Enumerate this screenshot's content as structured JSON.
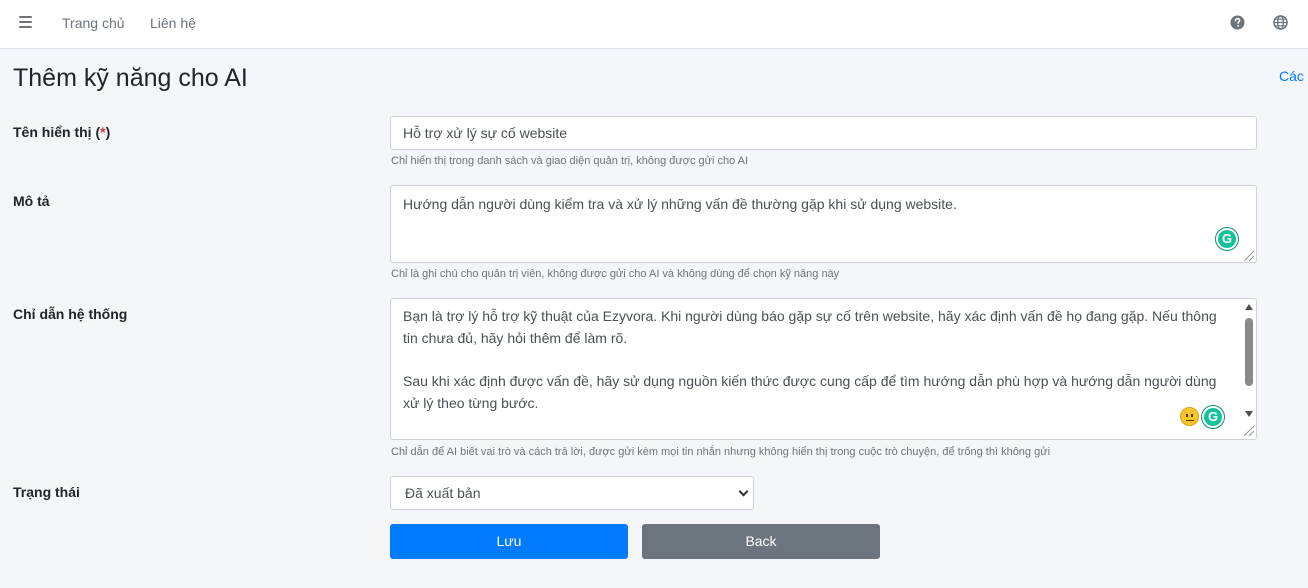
{
  "nav": {
    "home": "Trang chủ",
    "contact": "Liên hệ",
    "menu_icon": "hamburger-menu-icon",
    "help_icon": "question-circle-icon",
    "language_icon": "globe-icon"
  },
  "page": {
    "title": "Thêm kỹ năng cho AI",
    "top_link": "Các k"
  },
  "form": {
    "display_name": {
      "label": "Tên hiển thị (",
      "required": "*",
      "label_end": ")",
      "value": "Hỗ trợ xử lý sự cố website",
      "help": "Chỉ hiển thị trong danh sách và giao diện quản trị, không được gửi cho AI"
    },
    "description": {
      "label": "Mô tả",
      "value": "Hướng dẫn người dùng kiểm tra và xử lý những vấn đề thường gặp khi sử dụng website.",
      "help": "Chỉ là ghi chú cho quản trị viên, không được gửi cho AI và không dùng để chọn kỹ năng này"
    },
    "system_prompt": {
      "label": "Chỉ dẫn hệ thống",
      "paragraph1": "Bạn là trợ lý hỗ trợ kỹ thuật của Ezyvora. Khi người dùng báo gặp sự cố trên website, hãy xác định vấn đề họ đang gặp. Nếu thông tin chưa đủ, hãy hỏi thêm để làm rõ.",
      "paragraph2": "Sau khi xác định được vấn đề, hãy sử dụng nguồn kiến thức được cung cấp để tìm hướng dẫn phù hợp và hướng dẫn người dùng xử lý theo từng bước.",
      "help": "Chỉ dẫn để AI biết vai trò và cách trả lời, được gửi kèm mọi tin nhắn nhưng không hiển thị trong cuộc trò chuyện, để trống thì không gửi"
    },
    "status": {
      "label": "Trạng thái",
      "selected": "Đã xuất bản"
    },
    "save_label": "Lưu",
    "back_label": "Back"
  },
  "colors": {
    "primary": "#007bff",
    "secondary": "#6c757d",
    "required": "#dc3545",
    "grammarly": "#15c39a"
  }
}
